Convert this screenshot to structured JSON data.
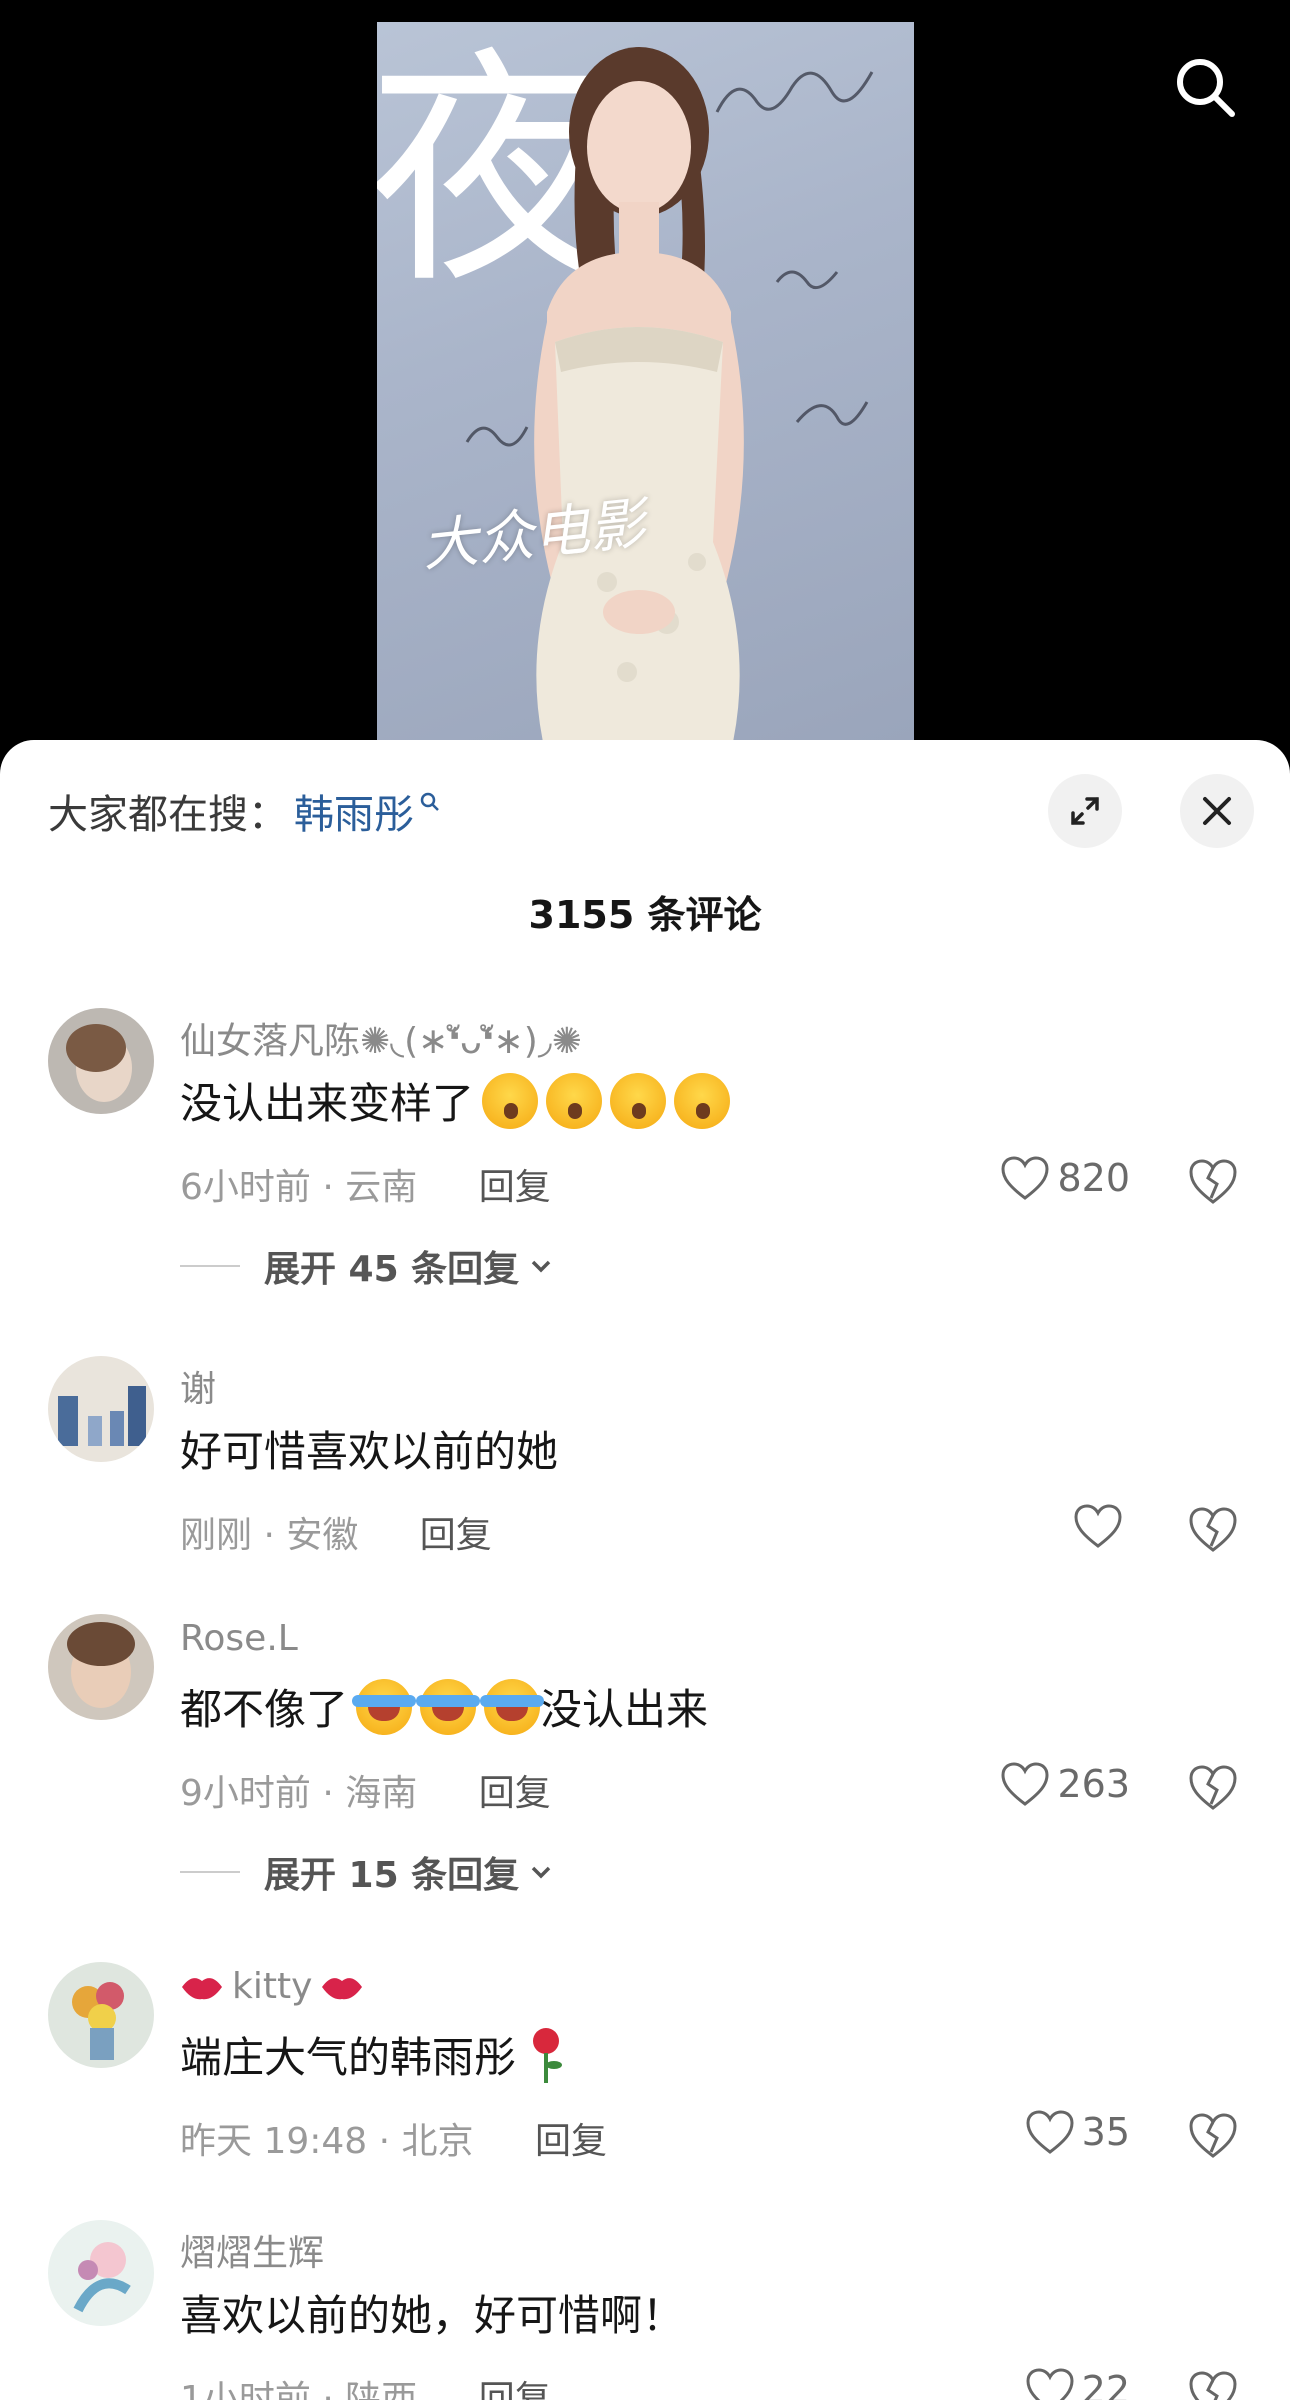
{
  "video": {
    "poster_character": "夜",
    "watermark": "大众电影"
  },
  "sheet": {
    "hot_search_prefix": "大家都在搜：",
    "hot_search_term": "韩雨彤",
    "comment_count": "3155 条评论"
  },
  "comments": [
    {
      "username": "仙女落凡陈✺◟(∗❛ัᴗ❛ั∗)◞✺",
      "text": "没认出来变样了",
      "emoji": [
        "shocked-face",
        "shocked-face",
        "shocked-face",
        "shocked-face"
      ],
      "time_location": "6小时前 · 云南",
      "reply_label": "回复",
      "likes": "820",
      "expand_label": "展开 45 条回复"
    },
    {
      "username": "谢",
      "text": "好可惜喜欢以前的她",
      "time_location": "刚刚 · 安徽",
      "reply_label": "回复",
      "likes": ""
    },
    {
      "username": "Rose.L",
      "text_before": "都不像了",
      "emoji": [
        "crying-laughing-face",
        "crying-laughing-face",
        "crying-laughing-face"
      ],
      "text_after": "没认出来",
      "time_location": "9小时前 · 海南",
      "reply_label": "回复",
      "likes": "263",
      "expand_label": "展开 15 条回复"
    },
    {
      "username": "kitty",
      "text": "端庄大气的韩雨彤",
      "time_location": "昨天 19:48 · 北京",
      "reply_label": "回复",
      "likes": "35"
    },
    {
      "username": "熠熠生辉",
      "text": "喜欢以前的她，好可惜啊！",
      "time_location": "1小时前 · 陕西",
      "reply_label": "回复",
      "likes": "22"
    }
  ],
  "colors": {
    "link_blue": "#2b5e9a",
    "sheet_bg": "#ffffff",
    "meta_gray": "#9a9a9a"
  }
}
